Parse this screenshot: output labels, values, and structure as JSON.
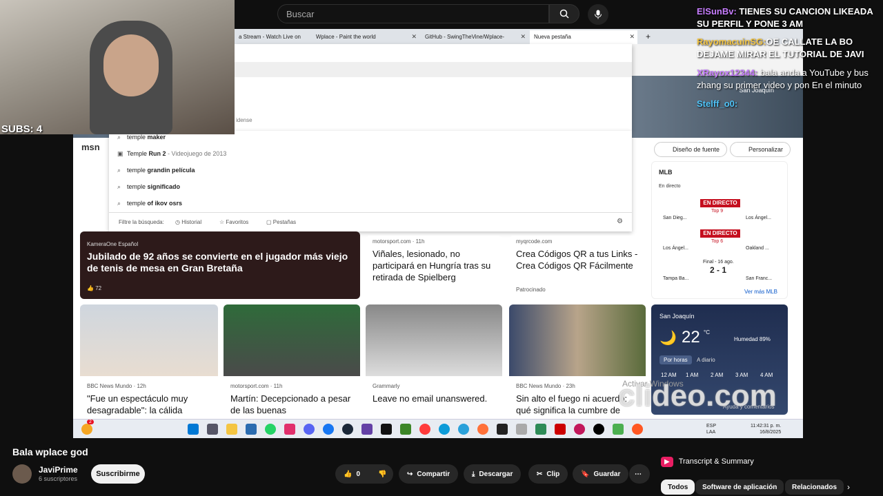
{
  "youtube": {
    "search_placeholder": "Buscar",
    "video_title": "Bala wplace god",
    "channel_name": "JaviPrime",
    "subscriber_count": "6 suscriptores",
    "subscribe_label": "Suscribirme",
    "like_count": "0",
    "share_label": "Compartir",
    "download_label": "Descargar",
    "clip_label": "Clip",
    "save_label": "Guardar",
    "transcript_label": "Transcript & Summary",
    "chips": [
      "Todos",
      "Software de aplicación",
      "Relacionados"
    ]
  },
  "stream": {
    "subs_label": "SUBS: 4",
    "chat": [
      {
        "user": "ElSunBv:",
        "text": "TIENES SU CANCION LIKEADA"
      },
      {
        "user": "",
        "text": "SU PERFIL Y PONE 3 AM"
      },
      {
        "user": "RayomacuinSG:",
        "text": "OE CALLATE LA BO"
      },
      {
        "user": "",
        "text": "DEJAME MIRAR EL TUTORIAL DE JAVI"
      },
      {
        "user": "XRayox12344:",
        "text": "bala anda a YouTube y bus"
      },
      {
        "user": "",
        "text": "zhang su primer video y pon En el minuto"
      },
      {
        "user": "Stelff_o0:",
        "text": ""
      }
    ],
    "watermark": "clideo.com"
  },
  "browser": {
    "tabs": [
      {
        "label": "a Stream - Watch Live on"
      },
      {
        "label": "Wplace - Paint the world"
      },
      {
        "label": "GitHub - SwingTheVine/Wplace-"
      },
      {
        "label": "Nueva pestaña"
      }
    ],
    "new_tab_symbol": "+",
    "suggestions": [
      {
        "prefix": "temple",
        "suffix": " maker",
        "extra": ""
      },
      {
        "prefix": "Temple",
        "suffix": " Run 2",
        "extra": " - Videojuego de 2013"
      },
      {
        "prefix": "temple",
        "suffix": " grandin película",
        "extra": ""
      },
      {
        "prefix": "temple",
        "suffix": " significado",
        "extra": ""
      },
      {
        "prefix": "temple",
        "suffix": " of ikov osrs",
        "extra": ""
      }
    ],
    "partial_text": "idense",
    "filter_label": "Filtre la búsqueda:",
    "filters": [
      "Historial",
      "Favoritos",
      "Pestañas"
    ]
  },
  "msn": {
    "logo": "msn",
    "location_top": "San Joaquín",
    "design_button": "Diseño de fuente",
    "personalize_button": "Personalizar",
    "hero": {
      "source": "KameraOne Español",
      "title": "Jubilado de 92 años se convierte en el jugador más viejo de tenis de mesa en Gran Bretaña",
      "likes": "72"
    },
    "cards_row1": [
      {
        "source": "motorsport.com · 11h",
        "title": "Viñales, lesionado, no participará en Hungría tras su retirada de Spielberg"
      },
      {
        "source": "myqrcode.com",
        "title": "Crea Códigos QR a tus Links - Crea Códigos QR Fácilmente",
        "sponsor": "Patrocinado"
      }
    ],
    "cards_row2": [
      {
        "source": "BBC News Mundo · 12h",
        "title": "\"Fue un espectáculo muy desagradable\": la cálida"
      },
      {
        "source": "motorsport.com · 11h",
        "title": "Martín: Decepcionado a pesar de las buenas"
      },
      {
        "source": "Grammarly",
        "title": "Leave no email unanswered."
      },
      {
        "source": "BBC News Mundo · 23h",
        "title": "Sin alto el fuego ni acuerdo: qué significa la cumbre de"
      }
    ],
    "mlb": {
      "title": "MLB",
      "live_label": "En directo",
      "games": [
        {
          "team1": "San Dieg...",
          "team2": "Los Ángel...",
          "status": "EN DIRECTO",
          "inning": "Top 9"
        },
        {
          "team1": "Los Ángel...",
          "team2": "Oakland ...",
          "status": "EN DIRECTO",
          "inning": "Top 6"
        },
        {
          "team1": "Tampa Ba...",
          "team2": "San Franc...",
          "status": "Final - 16 ago.",
          "score": "2 - 1"
        }
      ],
      "more": "Ver más MLB"
    },
    "weather": {
      "location": "San Joaquín",
      "temp": "22",
      "unit": "°C",
      "humidity": "Humedad 89%",
      "tab_hourly": "Por horas",
      "tab_daily": "A diario",
      "hours": [
        "12 AM",
        "1 AM",
        "2 AM",
        "3 AM",
        "4 AM"
      ],
      "footer": "Ayuda y comentarios"
    },
    "activate_windows": "Activar Windows"
  },
  "taskbar": {
    "lang": "ESP",
    "lang2": "LAA",
    "time": "11:42:31 p. m.",
    "date": "16/8/2025",
    "badge": "2"
  },
  "colors": {
    "yt_bg": "#0f0f0f",
    "live_red": "#c50f1f",
    "chat_user": "#c77dff"
  }
}
